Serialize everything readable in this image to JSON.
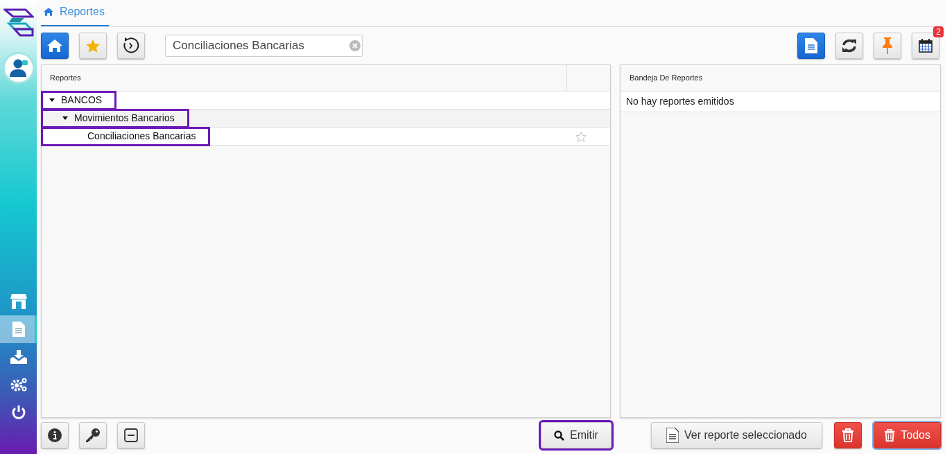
{
  "sidebar": {
    "items": [
      {
        "selected": false
      },
      {
        "selected": true
      },
      {
        "selected": false
      },
      {
        "selected": false
      },
      {
        "selected": false
      }
    ]
  },
  "breadcrumb_tab": {
    "label": "Reportes",
    "selected": true
  },
  "toolbar": {
    "left_buttons": [
      {
        "active": true
      },
      {
        "active": false
      },
      {
        "active": false
      }
    ],
    "search": {
      "value": "Conciliaciones Bancarias"
    },
    "right_buttons": [
      {
        "active": true
      },
      {
        "active": false
      },
      {
        "active": false
      },
      {
        "active": false,
        "badge": "2"
      }
    ]
  },
  "reports_panel": {
    "header": "Reportes",
    "tree": [
      {
        "label": "BANCOS",
        "expanded": true,
        "highlighted": true,
        "children": [
          {
            "label": "Movimientos Bancarios",
            "expanded": true,
            "highlighted": true,
            "children": [
              {
                "label": "Conciliaciones Bancarias",
                "highlighted": true,
                "favorite": false
              }
            ]
          }
        ]
      }
    ]
  },
  "tray_panel": {
    "header": "Bandeja De Reportes",
    "message": "No hay reportes emitidos"
  },
  "emit_button": {
    "label": "Emitir",
    "highlighted": true
  },
  "view_button": {
    "label": "Ver reporte seleccionado"
  },
  "delete_all_button": {
    "label": "Todos"
  }
}
